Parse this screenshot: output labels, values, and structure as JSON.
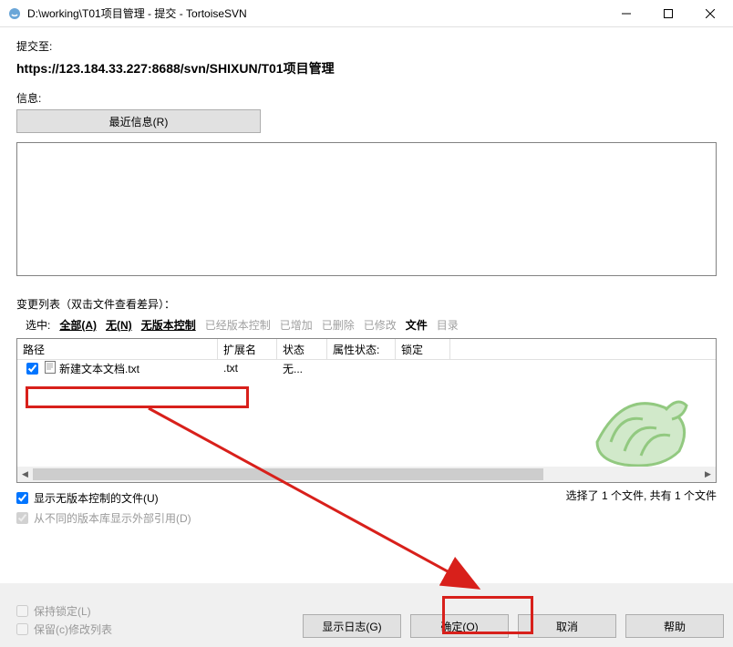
{
  "titlebar": {
    "title": "D:\\working\\T01项目管理 - 提交 - TortoiseSVN"
  },
  "commit_to_label": "提交至:",
  "url": "https://123.184.33.227:8688/svn/SHIXUN/T01项目管理",
  "info_label": "信息:",
  "recent_btn": "最近信息(R)",
  "changes_label": "变更列表（双击文件查看差异）：",
  "filters": {
    "selected_label": "选中:",
    "all": "全部(A)",
    "none": "无(N)",
    "unversioned": "无版本控制",
    "versioned": "已经版本控制",
    "added": "已增加",
    "deleted": "已删除",
    "modified": "已修改",
    "files": "文件",
    "dirs": "目录"
  },
  "columns": {
    "path": "路径",
    "ext": "扩展名",
    "status": "状态",
    "prop": "属性状态:",
    "lock": "锁定"
  },
  "rows": [
    {
      "checked": true,
      "name": "新建文本文档.txt",
      "ext": ".txt",
      "status": "无...",
      "prop": "",
      "lock": ""
    }
  ],
  "show_unversioned": {
    "label": "显示无版本控制的文件(U)",
    "checked": true
  },
  "show_externals": {
    "label": "从不同的版本库显示外部引用(D)",
    "checked": true
  },
  "summary": "选择了 1 个文件, 共有 1 个文件",
  "keep_locks": {
    "label": "保持锁定(L)",
    "checked": false
  },
  "keep_cl": {
    "label": "保留(c)修改列表",
    "checked": false
  },
  "buttons": {
    "log": "显示日志(G)",
    "ok": "确定(O)",
    "cancel": "取消",
    "help": "帮助"
  }
}
